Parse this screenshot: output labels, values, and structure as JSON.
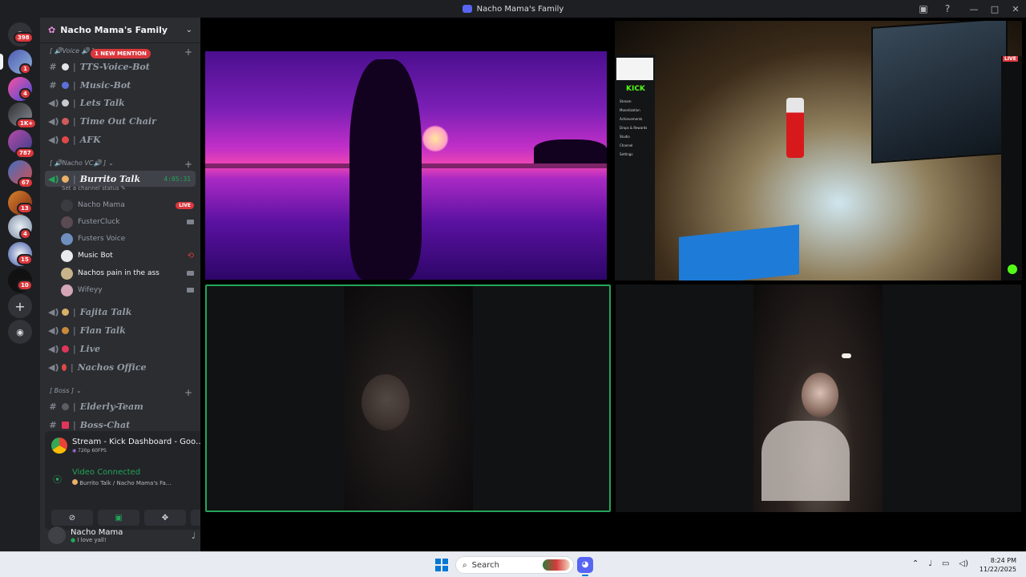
{
  "window": {
    "title": "Nacho Mama's Family",
    "controls": [
      "—",
      "□",
      "✕"
    ],
    "toolbar_icons": [
      "screen-share-icon",
      "help-icon"
    ]
  },
  "servers": [
    {
      "name": "discord-home",
      "badge": "398"
    },
    {
      "name": "server-1",
      "badge": "1"
    },
    {
      "name": "server-2",
      "badge": "4"
    },
    {
      "name": "server-3",
      "badge": "1K+"
    },
    {
      "name": "server-4",
      "badge": "787"
    },
    {
      "name": "server-5",
      "badge": "67"
    },
    {
      "name": "server-6",
      "badge": "13"
    },
    {
      "name": "server-7",
      "badge": "4"
    },
    {
      "name": "server-8",
      "badge": "15"
    },
    {
      "name": "server-9",
      "badge": "10"
    }
  ],
  "guild": {
    "name": "Nacho Mama's Family",
    "categories": [
      {
        "label": "[ 🔊Voice 🔊 ]"
      },
      {
        "label": "[ 🔊Nacho VC🔊 ]"
      },
      {
        "label": "[ Boss ]"
      }
    ],
    "new_mention": "1 NEW MENTION",
    "channels": [
      {
        "name": "TTS-Voice-Bot",
        "type": "text"
      },
      {
        "name": "Music-Bot",
        "type": "text"
      },
      {
        "name": "Lets Talk",
        "type": "voice"
      },
      {
        "name": "Time Out Chair",
        "type": "voice"
      },
      {
        "name": "AFK",
        "type": "voice"
      },
      {
        "name": "Burrito Talk",
        "type": "voice",
        "timer": "4:05:31",
        "status": "Set a channel status"
      },
      {
        "name": "Fajita Talk",
        "type": "voice"
      },
      {
        "name": "Flan Talk",
        "type": "voice"
      },
      {
        "name": "Live",
        "type": "voice"
      },
      {
        "name": "Nachos Office",
        "type": "voice"
      },
      {
        "name": "Elderly-Team",
        "type": "text"
      },
      {
        "name": "Boss-Chat",
        "type": "text"
      }
    ],
    "voice_users": [
      {
        "name": "Nacho Mama",
        "live": "LIVE"
      },
      {
        "name": "FusterCluck"
      },
      {
        "name": "Fusters Voice"
      },
      {
        "name": "Music Bot"
      },
      {
        "name": "Nachos pain in the ass"
      },
      {
        "name": "Wifeyy"
      }
    ]
  },
  "rtc": {
    "stream_title": "Stream - Kick Dashboard - Google ...",
    "stream_quality": "720p 60FPS",
    "status": "Video Connected",
    "channel_path": "Burrito Talk / Nacho Mama's Fa..."
  },
  "panel_user": {
    "name": "Nacho Mama",
    "status": "I love yall!"
  },
  "kick_overlay": {
    "logo": "KICK",
    "menu": [
      "Stream",
      "Monetization",
      "Achievements",
      "Drops & Rewards",
      "Studio",
      "Channel",
      "Settings"
    ],
    "live_tag": "LIVE"
  },
  "taskbar": {
    "search_placeholder": "Search",
    "time": "8:24 PM",
    "date": "11/22/2025"
  },
  "colors": {
    "accent": "#5865f2",
    "live_red": "#da373c",
    "connected_green": "#23a559",
    "tile_border": "#23a559"
  }
}
